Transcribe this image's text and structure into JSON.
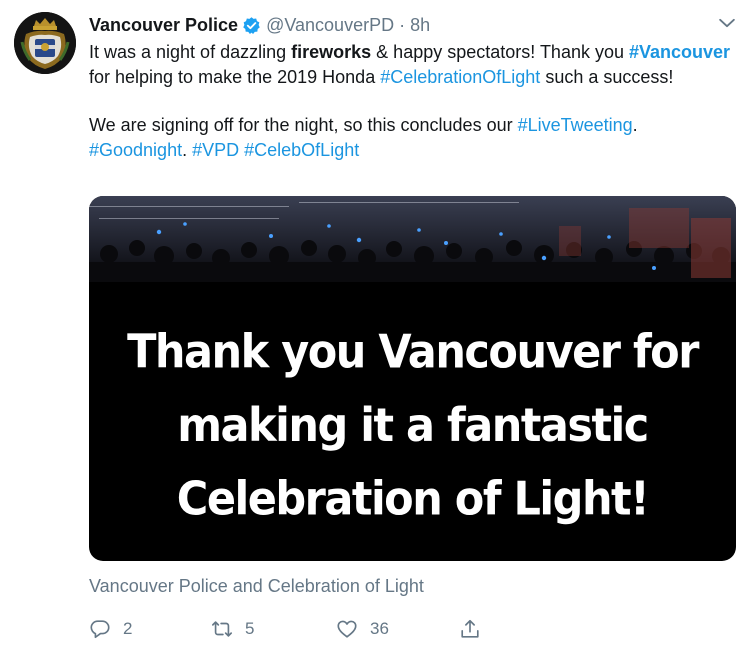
{
  "tweet": {
    "author": {
      "name": "Vancouver Police",
      "handle": "@VancouverPD",
      "verified": true,
      "avatar_icon": "police-crest"
    },
    "separator": "·",
    "time": "8h",
    "text": {
      "p1_a": "It was a night of dazzling ",
      "p1_bold": "fireworks",
      "p1_b": " & happy spectators! Thank you ",
      "p1_tag1": "#Vancouver",
      "p1_c": " for helping to make the 2019 Honda ",
      "p1_tag2": "#CelebrationOfLight",
      "p1_d": " such a success!",
      "p2_a": "We are signing off for the night, so this concludes our ",
      "p2_tag1": "#LiveTweeting",
      "p2_b": ". ",
      "p2_tag2": "#Goodnight",
      "p2_c": ". ",
      "p2_tag3": "#VPD",
      "p2_d": " ",
      "p2_tag4": "#CelebOfLight"
    },
    "media": {
      "image_text_line1": "Thank you Vancouver for",
      "image_text_line2": "making it a fantastic",
      "image_text_line3": "Celebration of Light!",
      "caption": "Vancouver Police and Celebration of Light"
    },
    "actions": {
      "reply_count": "2",
      "retweet_count": "5",
      "like_count": "36"
    }
  },
  "colors": {
    "link": "#1b95e0",
    "secondary_text": "#657786",
    "verified_badge": "#1da1f2",
    "media_background": "#000000"
  },
  "icons": [
    "police-crest",
    "verified-badge-icon",
    "chevron-down-icon",
    "reply-icon",
    "retweet-icon",
    "like-icon",
    "share-icon"
  ]
}
